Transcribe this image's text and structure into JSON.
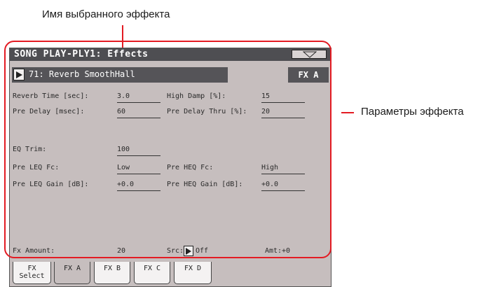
{
  "annotations": {
    "top": "Имя выбранного эффекта",
    "right": "Параметры эффекта"
  },
  "header": {
    "title": "SONG PLAY-PLY1: Effects"
  },
  "effect": {
    "name": "71: Reverb SmoothHall",
    "slot": "FX A"
  },
  "params": {
    "reverb_time": {
      "label": "Reverb Time [sec]:",
      "value": "3.0"
    },
    "high_damp": {
      "label": "High Damp [%]:",
      "value": "15"
    },
    "pre_delay": {
      "label": "Pre Delay [msec]:",
      "value": "60"
    },
    "pre_delay_thru": {
      "label": "Pre Delay Thru [%]:",
      "value": "20"
    },
    "eq_trim": {
      "label": "EQ Trim:",
      "value": "100"
    },
    "pre_leq_fc": {
      "label": "Pre LEQ Fc:",
      "value": "Low"
    },
    "pre_heq_fc": {
      "label": "Pre HEQ Fc:",
      "value": "High"
    },
    "pre_leq_gain": {
      "label": "Pre LEQ Gain [dB]:",
      "value": "+0.0"
    },
    "pre_heq_gain": {
      "label": "Pre HEQ Gain [dB]:",
      "value": "+0.0"
    },
    "fx_amount": {
      "label": "Fx Amount:",
      "value": "20"
    },
    "src": {
      "label": "Src:",
      "value": "Off"
    },
    "amt": {
      "label": "Amt:",
      "value": "+0"
    }
  },
  "tabs": [
    {
      "line1": "FX",
      "line2": "Select"
    },
    {
      "label": "FX A"
    },
    {
      "label": "FX B"
    },
    {
      "label": "FX C"
    },
    {
      "label": "FX D"
    }
  ],
  "colors": {
    "screen_bg": "#c6bebe",
    "titlebar": "#4e4e52",
    "highlight_red": "#e31b23"
  }
}
